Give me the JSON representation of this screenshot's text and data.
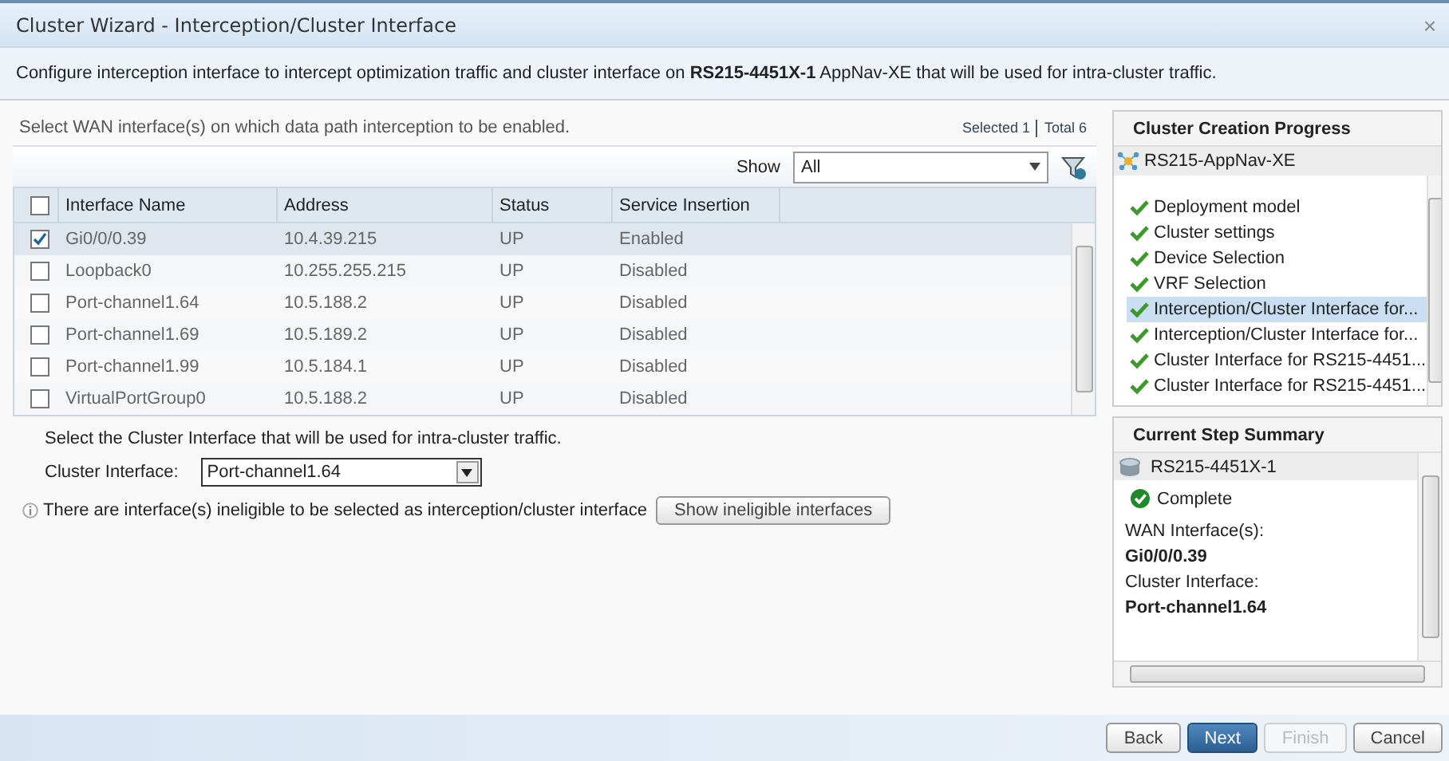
{
  "window": {
    "title": "Cluster Wizard - Interception/Cluster Interface",
    "close": "×"
  },
  "description": "Configure interception interface to intercept optimization traffic and cluster interface on **RS215-4451X-1** AppNav-XE that will be used for intra-cluster traffic.",
  "wan": {
    "prompt": "Select WAN interface(s) on which data path interception to be enabled.",
    "selected_count": "Selected 1",
    "total_count": "Total 6",
    "show_label": "Show",
    "show_value": "All",
    "columns": [
      "Interface Name",
      "Address",
      "Status",
      "Service Insertion"
    ],
    "all_checked": false,
    "rows": [
      {
        "name": "Gi0/0/0.39",
        "address": "10.4.39.215",
        "status": "UP",
        "service_insertion": "Enabled",
        "checked": true
      },
      {
        "name": "Loopback0",
        "address": "10.255.255.215",
        "status": "UP",
        "service_insertion": "Disabled",
        "checked": false
      },
      {
        "name": "Port-channel1.64",
        "address": "10.5.188.2",
        "status": "UP",
        "service_insertion": "Disabled",
        "checked": false
      },
      {
        "name": "Port-channel1.69",
        "address": "10.5.189.2",
        "status": "UP",
        "service_insertion": "Disabled",
        "checked": false
      },
      {
        "name": "Port-channel1.99",
        "address": "10.5.184.1",
        "status": "UP",
        "service_insertion": "Disabled",
        "checked": false
      },
      {
        "name": "VirtualPortGroup0",
        "address": "10.5.188.2",
        "status": "UP",
        "service_insertion": "Disabled",
        "checked": false
      }
    ]
  },
  "cluster": {
    "prompt": "Select the Cluster Interface that will be used for intra-cluster traffic.",
    "label": "Cluster Interface:",
    "value": "Port-channel1.64",
    "note": "There are interface(s) ineligible to be selected as interception/cluster interface",
    "note_button": "Show ineligible interfaces"
  },
  "progress": {
    "title": "Cluster Creation Progress",
    "root": "RS215-AppNav-XE",
    "steps": [
      {
        "label": "Deployment model",
        "done": true,
        "selected": false
      },
      {
        "label": "Cluster settings",
        "done": true,
        "selected": false
      },
      {
        "label": "Device Selection",
        "done": true,
        "selected": false
      },
      {
        "label": "VRF Selection",
        "done": true,
        "selected": false
      },
      {
        "label": "Interception/Cluster Interface for...",
        "done": true,
        "selected": true
      },
      {
        "label": "Interception/Cluster Interface for...",
        "done": true,
        "selected": false
      },
      {
        "label": "Cluster Interface for RS215-4451...",
        "done": true,
        "selected": false
      },
      {
        "label": "Cluster Interface for RS215-4451...",
        "done": true,
        "selected": false
      }
    ]
  },
  "summary": {
    "title": "Current Step Summary",
    "device": "RS215-4451X-1",
    "status": "Complete",
    "fields": [
      {
        "label": "WAN Interface(s):",
        "value": "Gi0/0/0.39"
      },
      {
        "label": "Cluster Interface:",
        "value": "Port-channel1.64"
      }
    ]
  },
  "buttons": [
    {
      "label": "Back",
      "kind": "normal",
      "disabled": false
    },
    {
      "label": "Next",
      "kind": "primary",
      "disabled": false
    },
    {
      "label": "Finish",
      "kind": "normal",
      "disabled": true
    },
    {
      "label": "Cancel",
      "kind": "normal",
      "disabled": false
    }
  ]
}
